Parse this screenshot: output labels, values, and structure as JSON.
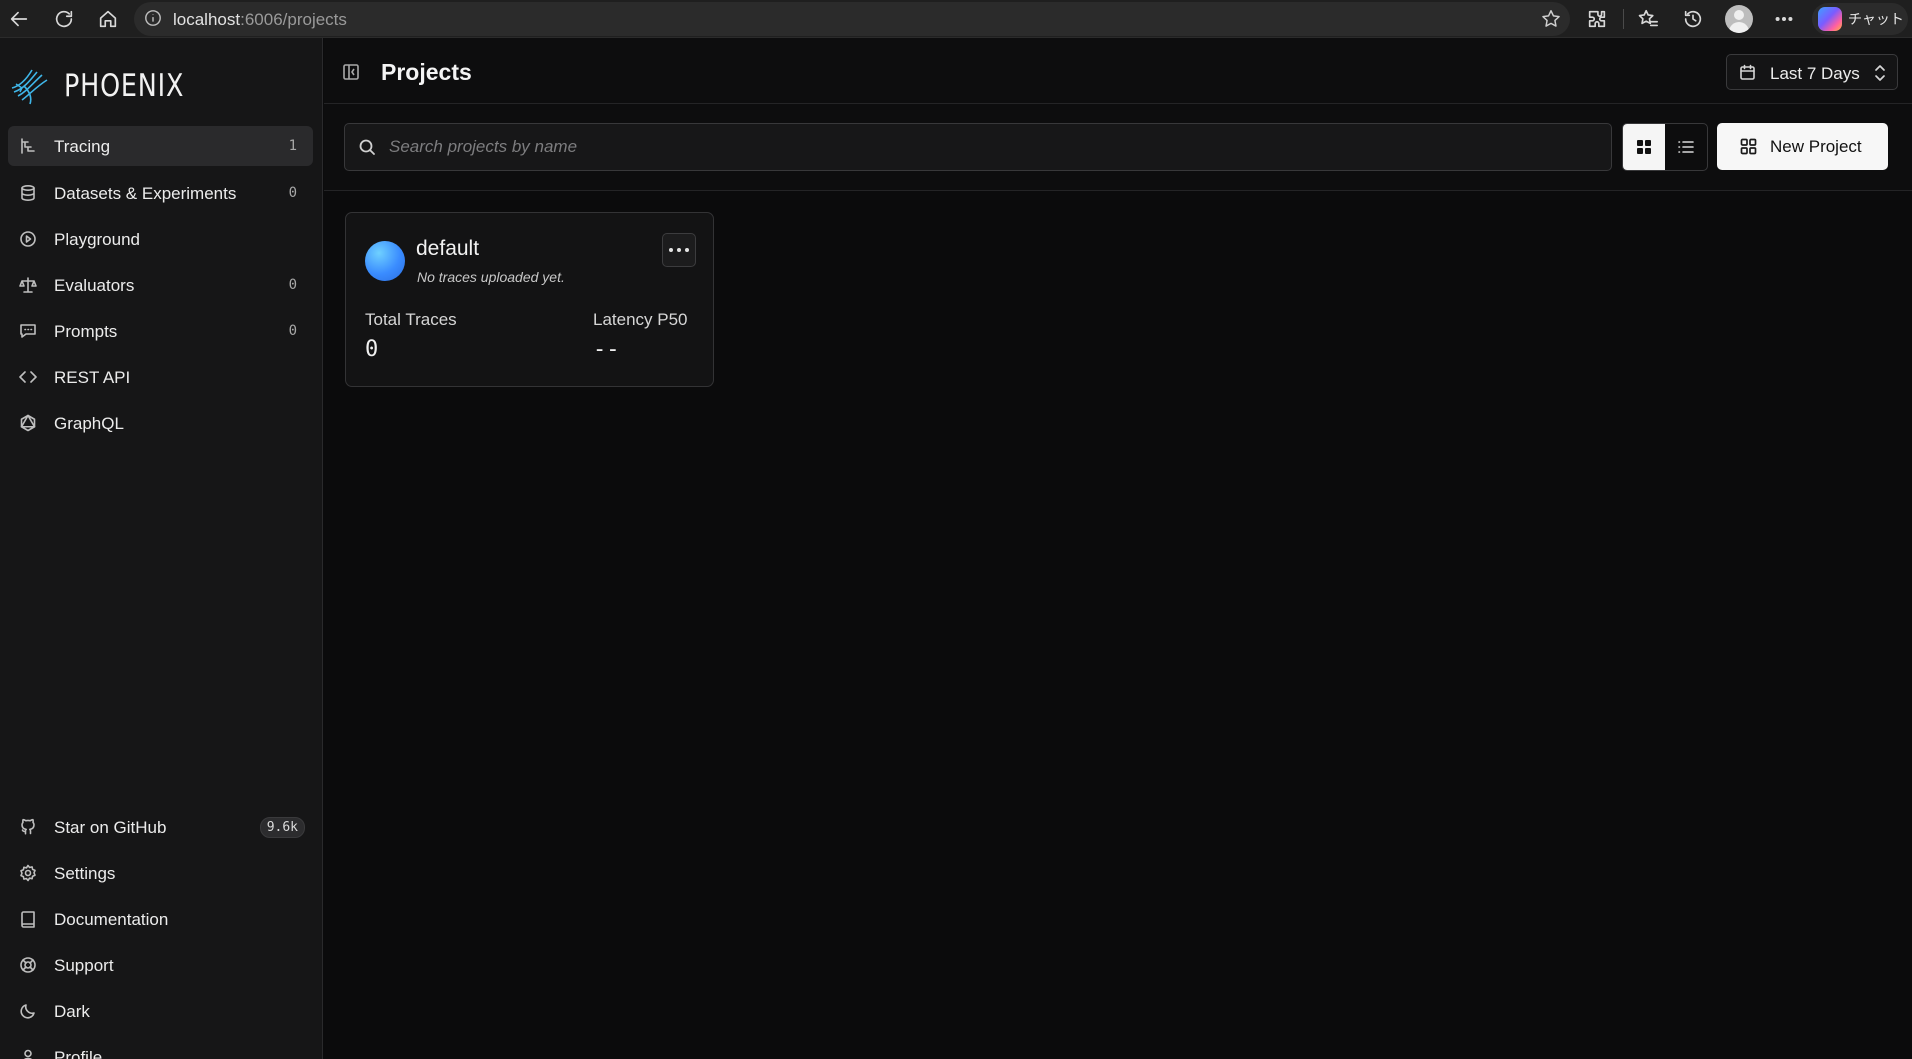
{
  "browser": {
    "url_host": "localhost",
    "url_path": ":6006/projects",
    "copilot_label": "チャット"
  },
  "sidebar": {
    "logo_text": "PHOENIX",
    "nav": [
      {
        "label": "Tracing",
        "count": "1",
        "icon": "tracing-icon"
      },
      {
        "label": "Datasets & Experiments",
        "count": "0",
        "icon": "database-icon"
      },
      {
        "label": "Playground",
        "count": "",
        "icon": "play-circle-icon"
      },
      {
        "label": "Evaluators",
        "count": "0",
        "icon": "scale-icon"
      },
      {
        "label": "Prompts",
        "count": "0",
        "icon": "message-icon"
      },
      {
        "label": "REST API",
        "count": "",
        "icon": "code-icon"
      },
      {
        "label": "GraphQL",
        "count": "",
        "icon": "graphql-icon"
      }
    ],
    "bottom": [
      {
        "label": "Star on GitHub",
        "badge": "9.6k",
        "icon": "github-icon"
      },
      {
        "label": "Settings",
        "icon": "gear-icon"
      },
      {
        "label": "Documentation",
        "icon": "book-icon"
      },
      {
        "label": "Support",
        "icon": "lifebuoy-icon"
      },
      {
        "label": "Dark",
        "icon": "moon-icon"
      },
      {
        "label": "Profile",
        "icon": "user-icon"
      }
    ]
  },
  "header": {
    "title": "Projects",
    "time_range": "Last 7 Days"
  },
  "toolbar": {
    "search_placeholder": "Search projects by name",
    "new_project_label": "New Project",
    "view_mode": "grid"
  },
  "projects": [
    {
      "name": "default",
      "subtitle": "No traces uploaded yet.",
      "total_traces_label": "Total Traces",
      "total_traces": "0",
      "latency_label": "Latency P50",
      "latency": "--"
    }
  ],
  "colors": {
    "accent_blue": "#3a8cff",
    "background": "#0b0b0c",
    "sidebar": "#161617"
  }
}
